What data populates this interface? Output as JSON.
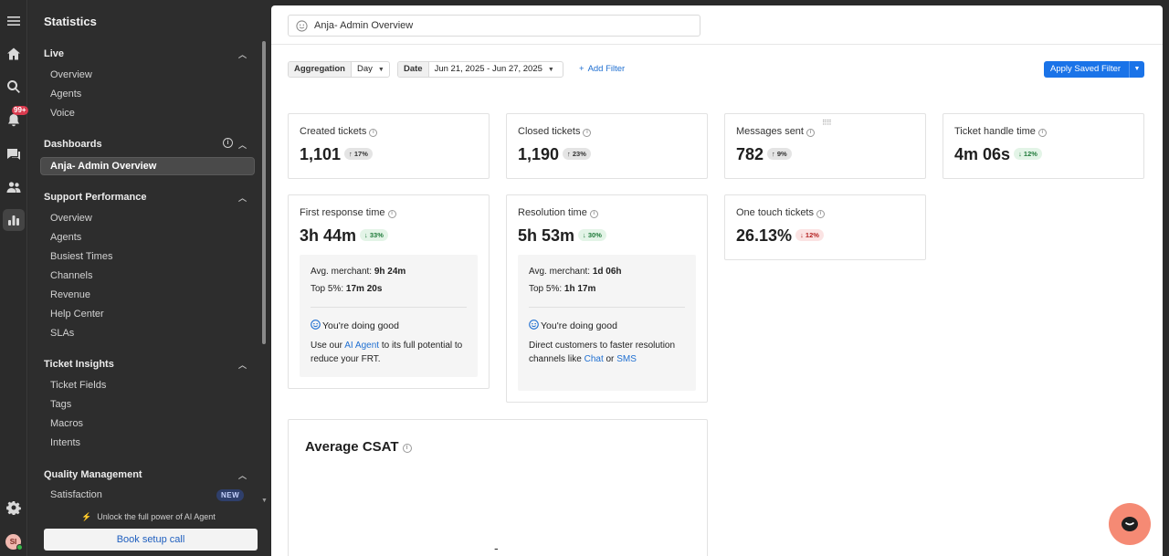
{
  "rail": {
    "notification_badge": "99+",
    "avatar_initials": "SI",
    "icons": [
      "menu-icon",
      "home-icon",
      "search-icon",
      "bell-icon",
      "chat-icon",
      "users-icon",
      "bar-chart-icon",
      "settings-icon"
    ]
  },
  "sidebar": {
    "title": "Statistics",
    "live": {
      "label": "Live",
      "items": [
        "Overview",
        "Agents",
        "Voice"
      ]
    },
    "dashboards": {
      "label": "Dashboards",
      "active_item": "Anja- Admin Overview"
    },
    "support_performance": {
      "label": "Support Performance",
      "items": [
        "Overview",
        "Agents",
        "Busiest Times",
        "Channels",
        "Revenue",
        "Help Center",
        "SLAs"
      ]
    },
    "ticket_insights": {
      "label": "Ticket Insights",
      "items": [
        "Ticket Fields",
        "Tags",
        "Macros",
        "Intents"
      ]
    },
    "quality_management": {
      "label": "Quality Management",
      "items": [
        "Satisfaction"
      ],
      "new_badge": "NEW"
    },
    "unlock_text": "Unlock the full power of AI Agent",
    "book_button": "Book setup call"
  },
  "main": {
    "dashboard_title": "Anja- Admin Overview",
    "filters": {
      "aggregation_label": "Aggregation",
      "aggregation_value": "Day",
      "date_label": "Date",
      "date_value": "Jun 21, 2025 - Jun 27, 2025",
      "add_filter": "Add Filter",
      "apply_saved_filter": "Apply Saved Filter"
    },
    "cards": {
      "created": {
        "title": "Created tickets",
        "value": "1,101",
        "change": "17%",
        "direction": "up"
      },
      "closed": {
        "title": "Closed tickets",
        "value": "1,190",
        "change": "23%",
        "direction": "up"
      },
      "messages": {
        "title": "Messages sent",
        "value": "782",
        "change": "9%",
        "direction": "up"
      },
      "handle_time": {
        "title": "Ticket handle time",
        "value": "4m 06s",
        "change": "12%",
        "direction": "down"
      },
      "frt": {
        "title": "First response time",
        "value": "3h 44m",
        "change": "33%",
        "direction": "down",
        "avg_label": "Avg. merchant:",
        "avg_value": "9h 24m",
        "top_label": "Top 5%:",
        "top_value": "17m 20s",
        "good": "You're doing good",
        "msg_before": "Use our",
        "msg_link": "AI Agent",
        "msg_after": "to its full potential to reduce your FRT."
      },
      "resolution": {
        "title": "Resolution time",
        "value": "5h 53m",
        "change": "30%",
        "direction": "down",
        "avg_label": "Avg. merchant:",
        "avg_value": "1d 06h",
        "top_label": "Top 5%:",
        "top_value": "1h 17m",
        "good": "You're doing good",
        "msg_before": "Direct customers to faster resolution channels like",
        "msg_link1": "Chat",
        "msg_or": "or",
        "msg_link2": "SMS"
      },
      "one_touch": {
        "title": "One touch tickets",
        "value": "26.13%",
        "change": "12%",
        "direction": "down"
      }
    },
    "csat": {
      "title": "Average CSAT",
      "value": "-"
    }
  },
  "colors": {
    "accent": "#1a73e8",
    "up_pill": "#e4e4e4",
    "down_good": "#e3f4e7",
    "down_bad": "#fbe3e3",
    "chat_bubble": "#f58a74"
  }
}
